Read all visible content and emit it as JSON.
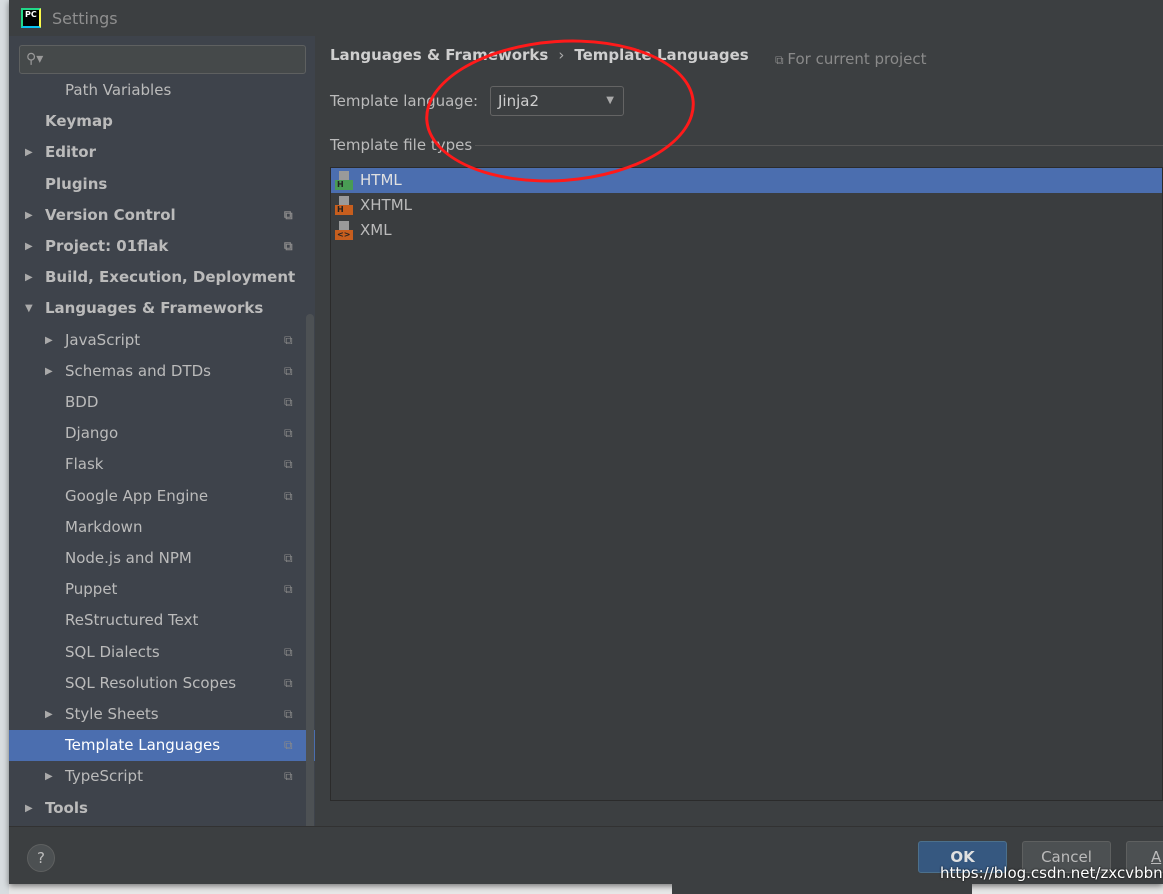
{
  "window": {
    "title": "Settings"
  },
  "search": {
    "placeholder": ""
  },
  "tree": [
    {
      "label": "Path Variables",
      "level": 1,
      "bold": false,
      "arrow": "",
      "project": false
    },
    {
      "label": "Keymap",
      "level": 0,
      "bold": true,
      "arrow": "",
      "project": false
    },
    {
      "label": "Editor",
      "level": 0,
      "bold": true,
      "arrow": "right",
      "project": false
    },
    {
      "label": "Plugins",
      "level": 0,
      "bold": true,
      "arrow": "",
      "project": false
    },
    {
      "label": "Version Control",
      "level": 0,
      "bold": true,
      "arrow": "right",
      "project": true
    },
    {
      "label": "Project: 01flak",
      "level": 0,
      "bold": true,
      "arrow": "right",
      "project": true
    },
    {
      "label": "Build, Execution, Deployment",
      "level": 0,
      "bold": true,
      "arrow": "right",
      "project": false
    },
    {
      "label": "Languages & Frameworks",
      "level": 0,
      "bold": true,
      "arrow": "down",
      "project": false
    },
    {
      "label": "JavaScript",
      "level": 1,
      "bold": false,
      "arrow": "right",
      "project": true
    },
    {
      "label": "Schemas and DTDs",
      "level": 1,
      "bold": false,
      "arrow": "right",
      "project": true
    },
    {
      "label": "BDD",
      "level": 1,
      "bold": false,
      "arrow": "",
      "project": true
    },
    {
      "label": "Django",
      "level": 1,
      "bold": false,
      "arrow": "",
      "project": true
    },
    {
      "label": "Flask",
      "level": 1,
      "bold": false,
      "arrow": "",
      "project": true
    },
    {
      "label": "Google App Engine",
      "level": 1,
      "bold": false,
      "arrow": "",
      "project": true
    },
    {
      "label": "Markdown",
      "level": 1,
      "bold": false,
      "arrow": "",
      "project": false
    },
    {
      "label": "Node.js and NPM",
      "level": 1,
      "bold": false,
      "arrow": "",
      "project": true
    },
    {
      "label": "Puppet",
      "level": 1,
      "bold": false,
      "arrow": "",
      "project": true
    },
    {
      "label": "ReStructured Text",
      "level": 1,
      "bold": false,
      "arrow": "",
      "project": false
    },
    {
      "label": "SQL Dialects",
      "level": 1,
      "bold": false,
      "arrow": "",
      "project": true
    },
    {
      "label": "SQL Resolution Scopes",
      "level": 1,
      "bold": false,
      "arrow": "",
      "project": true
    },
    {
      "label": "Style Sheets",
      "level": 1,
      "bold": false,
      "arrow": "right",
      "project": true
    },
    {
      "label": "Template Languages",
      "level": 1,
      "bold": false,
      "arrow": "",
      "project": true,
      "selected": true
    },
    {
      "label": "TypeScript",
      "level": 1,
      "bold": false,
      "arrow": "right",
      "project": true
    },
    {
      "label": "Tools",
      "level": 0,
      "bold": true,
      "arrow": "right",
      "project": false
    }
  ],
  "main": {
    "breadcrumb": [
      "Languages & Frameworks",
      "Template Languages"
    ],
    "breadcrumb_sep": "›",
    "for_current_project": "For current project",
    "template_language_label": "Template language:",
    "template_language_value": "Jinja2",
    "file_types_label": "Template file types",
    "file_types": [
      {
        "name": "HTML",
        "badge": "H",
        "color": "#499c54",
        "selected": true
      },
      {
        "name": "XHTML",
        "badge": "H",
        "color": "#c75e1e",
        "selected": false
      },
      {
        "name": "XML",
        "badge": "<>",
        "color": "#c75e1e",
        "selected": false
      }
    ]
  },
  "footer": {
    "help": "?",
    "ok": "OK",
    "cancel": "Cancel",
    "apply": "A"
  },
  "watermark": "https://blog.csdn.net/zxcvbbnn",
  "colors": {
    "selection": "#4b6eaf",
    "annotation": "#ff1a1a"
  }
}
